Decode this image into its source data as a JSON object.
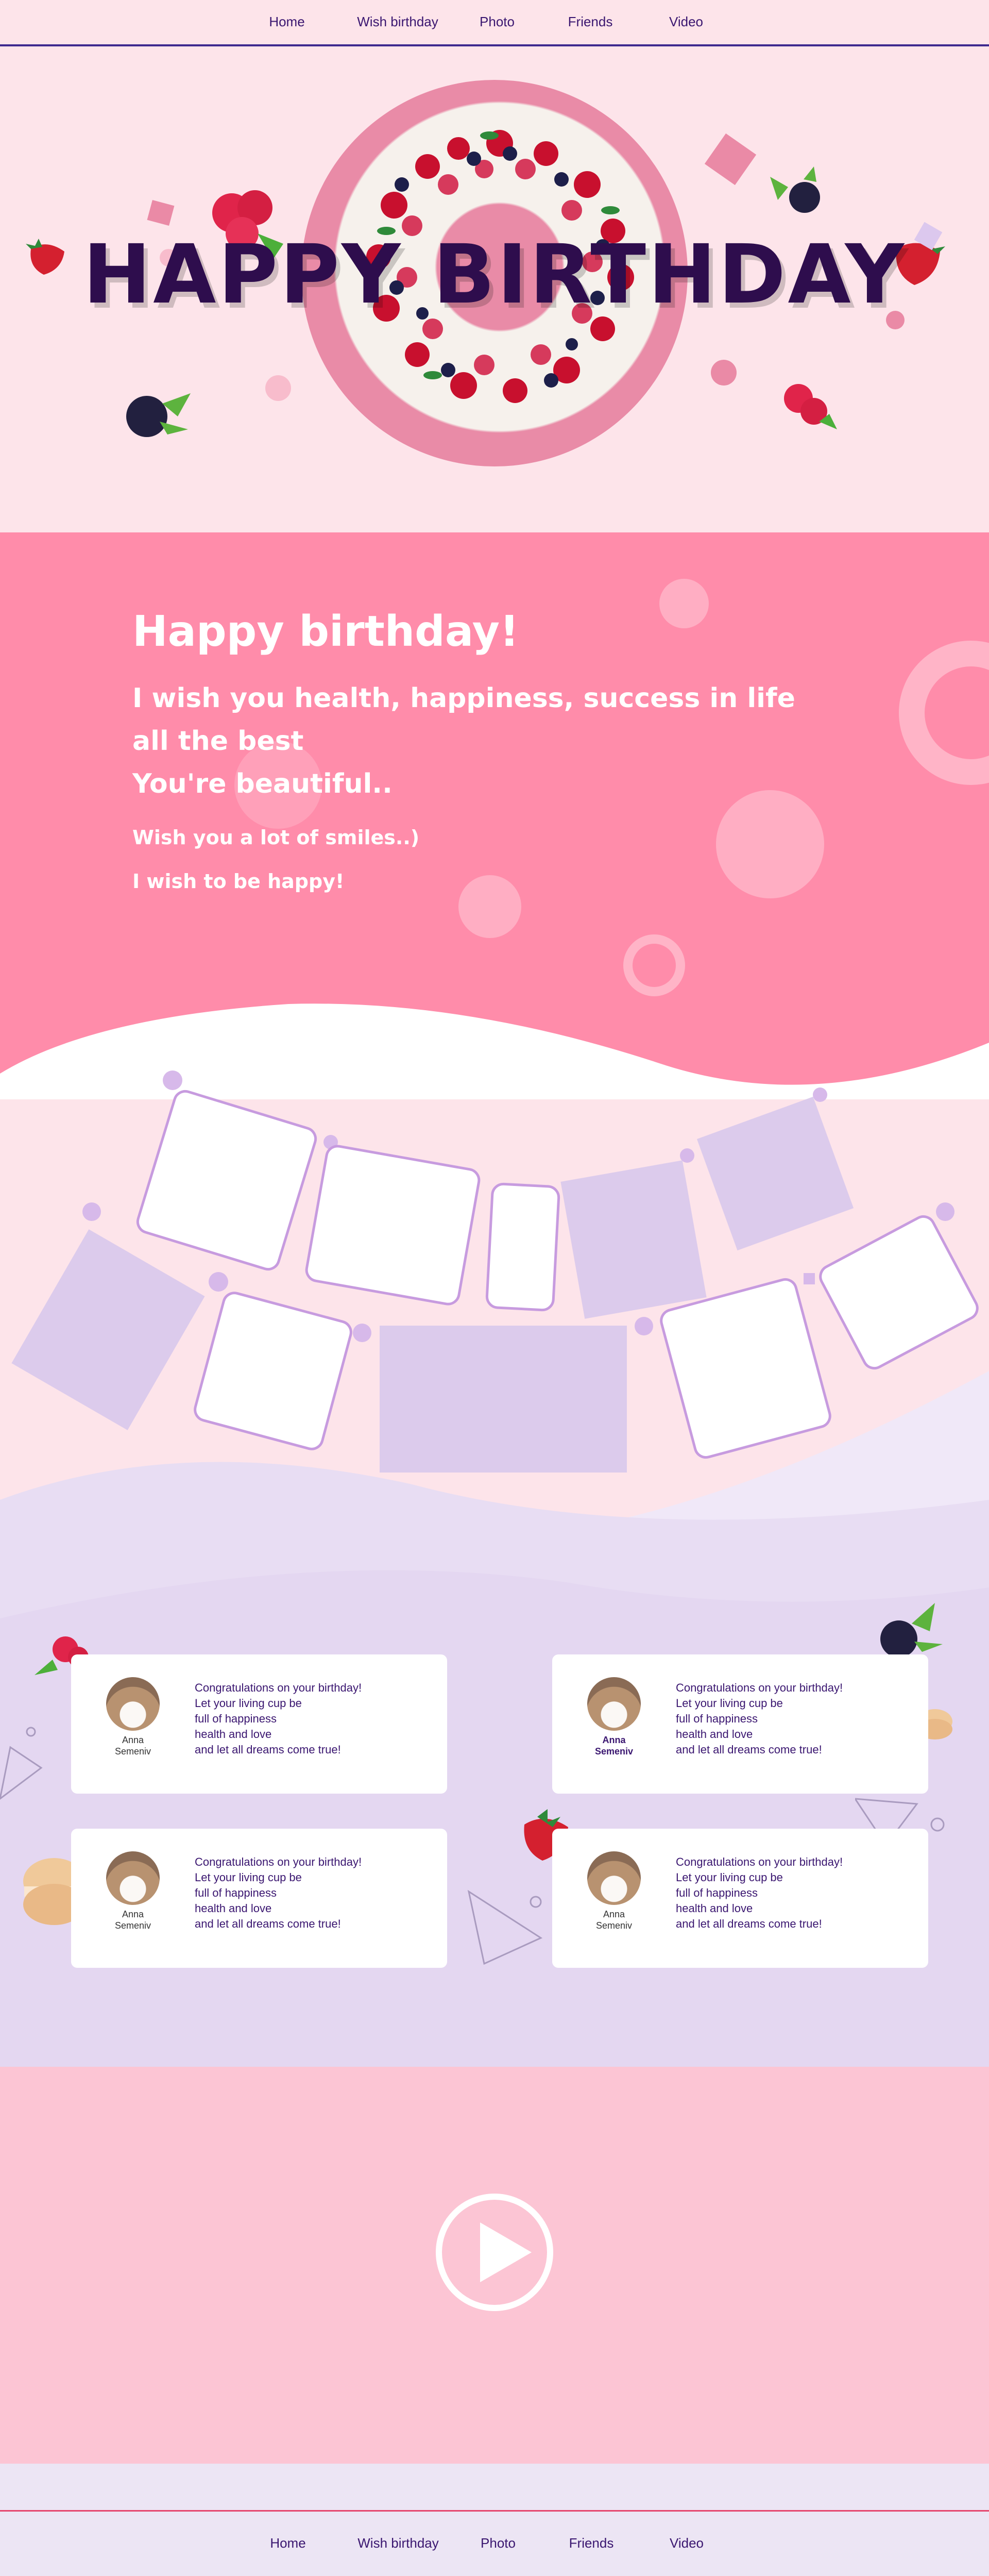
{
  "nav": {
    "items": [
      "Home",
      "Wish birthday",
      "Photo",
      "Friends",
      "Video"
    ]
  },
  "hero": {
    "title": "HAPPY BIRTHDAY"
  },
  "wish": {
    "heading": "Happy birthday!",
    "line1": "I wish you health, happiness, success in life",
    "line2": "all the best",
    "line3": "You're beautiful..",
    "line4": "Wish you a lot of smiles..)",
    "line5": "I wish to be happy!"
  },
  "friends": {
    "cards": [
      {
        "name": "Anna\nSemeniv",
        "message": "Congratulations on your birthday!\nLet your living cup be\nfull of happiness\nhealth and love\nand let all dreams come true!"
      },
      {
        "name": "Anna\nSemeniv",
        "message": "Congratulations on your birthday!\nLet your living cup be\nfull of happiness\nhealth and love\nand let all dreams come true!"
      },
      {
        "name": "Anna\nSemeniv",
        "message": "Congratulations on your birthday!\nLet your living cup be\nfull of happiness\nhealth and love\nand let all dreams come true!"
      },
      {
        "name": "Anna\nSemeniv",
        "message": "Congratulations on your birthday!\nLet your living cup be\nfull of happiness\nhealth and love\nand let all dreams come true!"
      }
    ]
  },
  "colors": {
    "accent": "#3a1670",
    "pink": "#ff8caa",
    "lavender": "#e4d7f1",
    "frame": "#c79bdf"
  }
}
